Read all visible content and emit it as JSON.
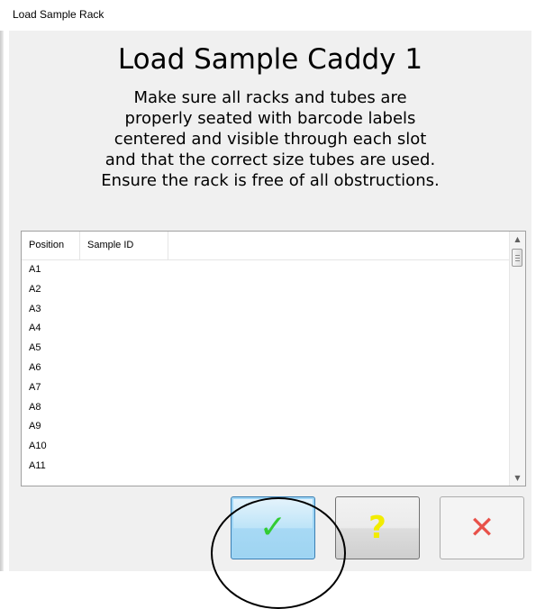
{
  "window": {
    "title": "Load Sample Rack"
  },
  "dialog": {
    "heading": "Load Sample Caddy 1",
    "instructions": [
      "Make sure all racks and tubes are",
      "properly seated with barcode labels",
      "centered and visible through each slot",
      "and that the correct size tubes are used.",
      "Ensure the rack is free of all obstructions."
    ]
  },
  "table": {
    "columns": [
      "Position",
      "Sample ID"
    ],
    "rows": [
      {
        "position": "A1",
        "sample_id": ""
      },
      {
        "position": "A2",
        "sample_id": ""
      },
      {
        "position": "A3",
        "sample_id": ""
      },
      {
        "position": "A4",
        "sample_id": ""
      },
      {
        "position": "A5",
        "sample_id": ""
      },
      {
        "position": "A6",
        "sample_id": ""
      },
      {
        "position": "A7",
        "sample_id": ""
      },
      {
        "position": "A8",
        "sample_id": ""
      },
      {
        "position": "A9",
        "sample_id": ""
      },
      {
        "position": "A10",
        "sample_id": ""
      },
      {
        "position": "A11",
        "sample_id": ""
      }
    ],
    "scroll": {
      "up_icon": "scroll-up-arrow-icon",
      "down_icon": "scroll-down-arrow-icon",
      "up_glyph": "▲",
      "down_glyph": "▼"
    }
  },
  "buttons": {
    "ok": {
      "icon": "checkmark-icon",
      "glyph": "✓",
      "color": "#33cc33"
    },
    "help": {
      "icon": "question-mark-icon",
      "glyph": "?",
      "color": "#f2ec00"
    },
    "cancel": {
      "icon": "close-x-icon",
      "glyph": "✕",
      "color": "#e8524a"
    }
  },
  "colors": {
    "dialog_background": "#f0f0f0",
    "ok_button_highlight": "#9ed4f1"
  }
}
